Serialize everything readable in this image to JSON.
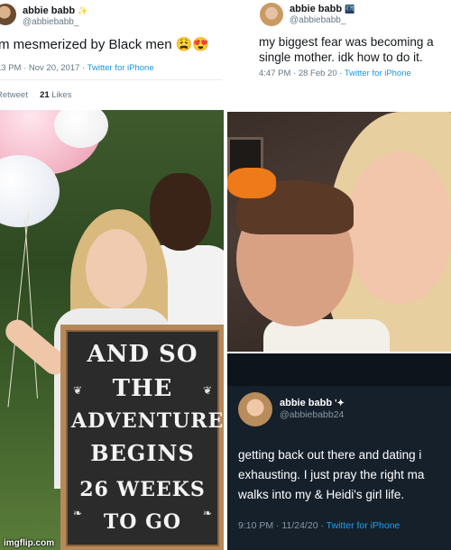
{
  "tweet1": {
    "name": "abbie babb",
    "verified_glyph": "✨",
    "handle": "@abbiebabb_",
    "text": "m mesmerized by Black men",
    "emoji": "😩😍",
    "time": "13 PM · Nov 20, 2017 · ",
    "source": "Twitter for iPhone",
    "retweets_label": "Retweet",
    "likes_count": "21",
    "likes_label": "Likes"
  },
  "tweet2": {
    "name": "abbie babb",
    "badge_glyph": "🌃",
    "handle": "@abbiebabb_",
    "text": "my biggest fear was becoming a single mother. idk how to do it.",
    "time": "4:47 PM · 28 Feb 20 · ",
    "source": "Twitter for iPhone"
  },
  "photo1": {
    "chalkboard_lines": [
      "AND SO",
      "THE",
      "ADVENTURE",
      "BEGINS",
      "26 WEEKS",
      "TO GO"
    ],
    "watermark": "imgflip.com"
  },
  "tweet3": {
    "name": "abbie babb",
    "badge_glyph": "'✦",
    "handle": "@abbiebabb24",
    "lines": [
      "getting back out there and dating i",
      "exhausting. I just pray the right ma",
      "walks into my & Heidi's girl life."
    ],
    "time": "9:10 PM · 11/24/20 · ",
    "source": "Twitter for iPhone"
  },
  "colors": {
    "twitter_blue": "#1b95e0",
    "dark_bg": "#15202b",
    "chalkboard": "#2b2b2b",
    "frame_wood": "#b5895a",
    "bow_orange": "#ef7a1a"
  }
}
